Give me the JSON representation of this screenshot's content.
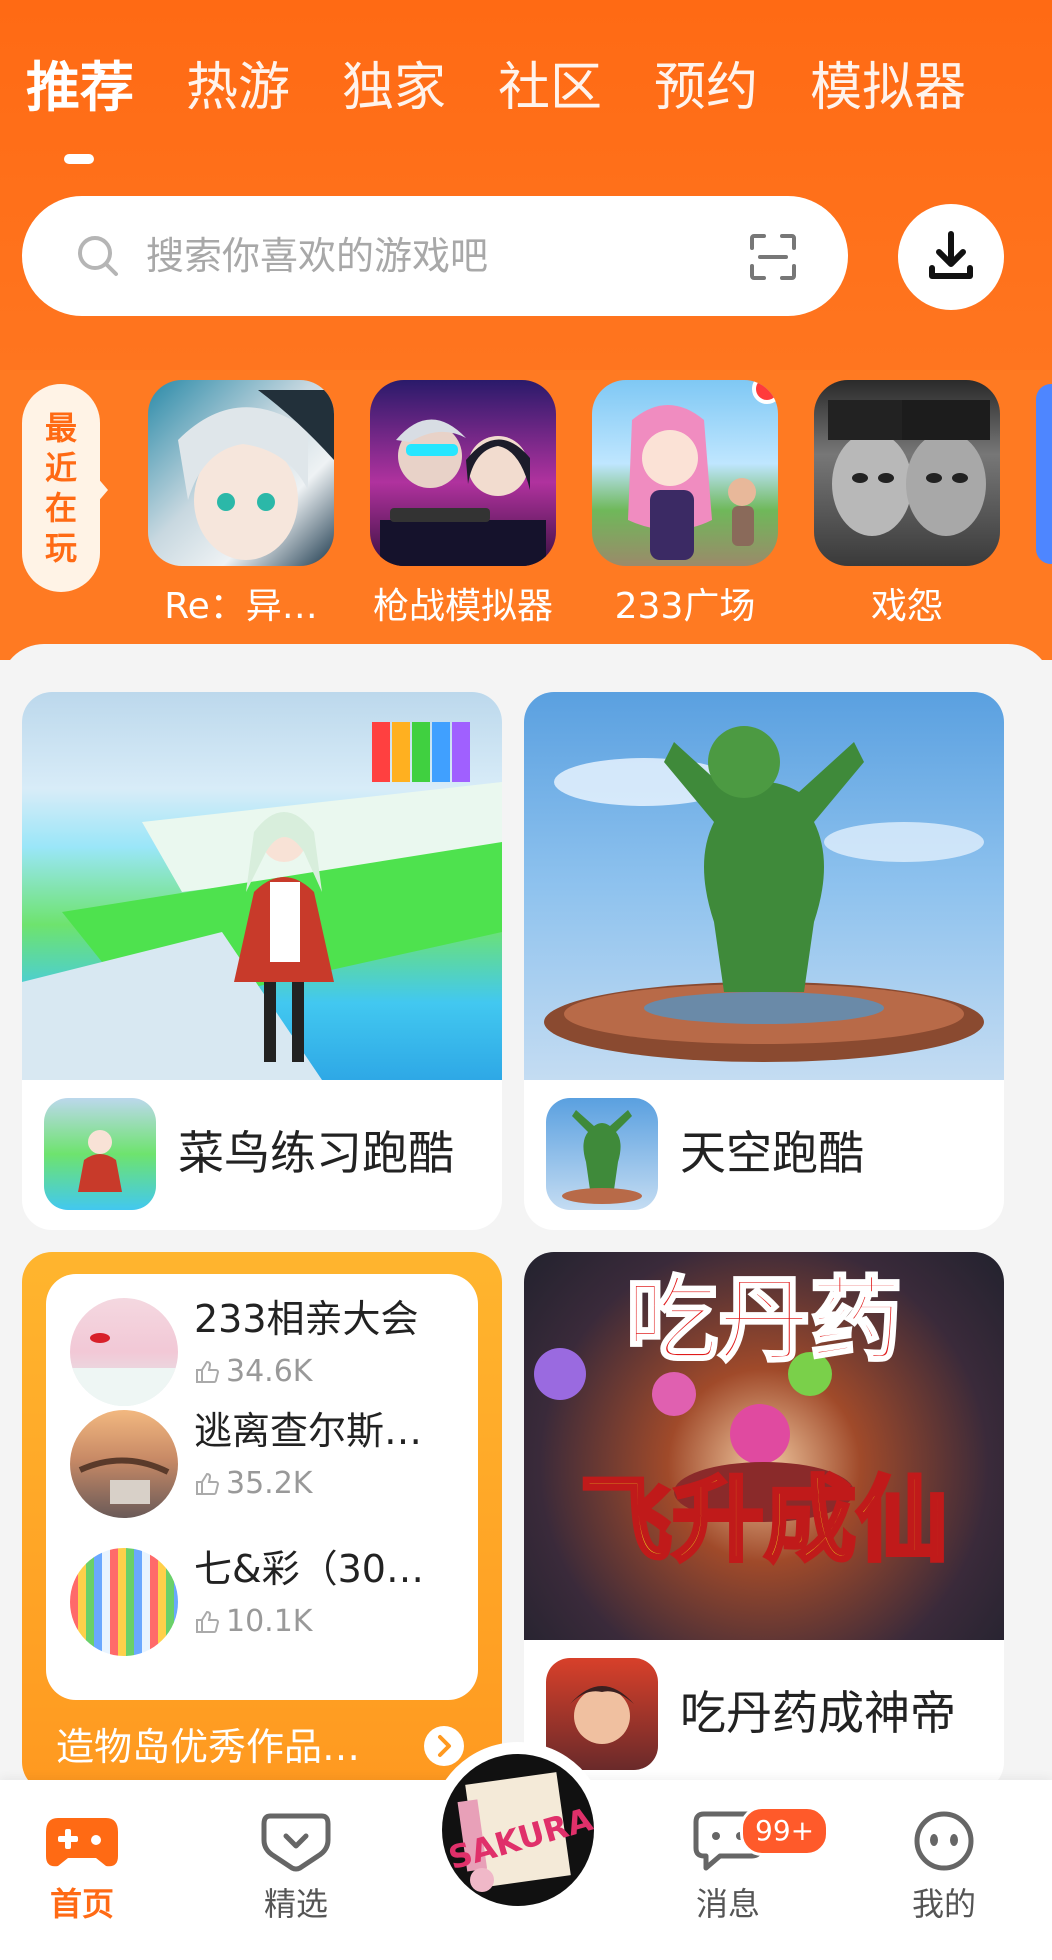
{
  "tabs": [
    "推荐",
    "热游",
    "独家",
    "社区",
    "预约",
    "模拟器"
  ],
  "search": {
    "placeholder": "搜索你喜欢的游戏吧"
  },
  "recent": {
    "label": [
      "最",
      "近",
      "在",
      "玩"
    ],
    "games": [
      {
        "name": "Re：异…"
      },
      {
        "name": "枪战模拟器"
      },
      {
        "name": "233广场"
      },
      {
        "name": "戏怨"
      }
    ]
  },
  "cards": [
    {
      "title": "菜鸟练习跑酷"
    },
    {
      "title": "天空跑酷"
    },
    {
      "title": "吃丹药成神帝",
      "banner_text_top": "吃丹药",
      "banner_text_bottom": "飞升成仙"
    }
  ],
  "ugc": {
    "items": [
      {
        "name": "233相亲大会",
        "likes": "34.6K"
      },
      {
        "name": "逃离查尔斯…",
        "likes": "35.2K"
      },
      {
        "name": "七&彩（30…",
        "likes": "10.1K"
      }
    ],
    "footer": "造物岛优秀作品…"
  },
  "nav": {
    "home": "首页",
    "featured": "精选",
    "messages": "消息",
    "mine": "我的",
    "badge": "99+",
    "center_text": "SAKURA"
  },
  "colors": {
    "accent": "#ff6a14",
    "badge": "#ff5a2a"
  }
}
